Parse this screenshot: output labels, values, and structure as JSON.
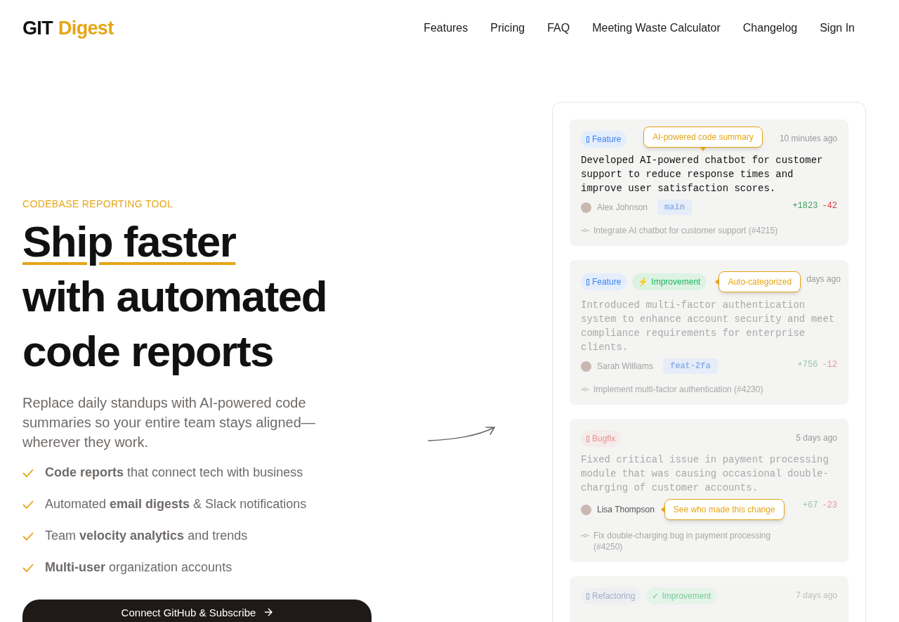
{
  "logo": {
    "first": "GIT",
    "second": "Digest"
  },
  "nav": [
    {
      "label": "Features"
    },
    {
      "label": "Pricing"
    },
    {
      "label": "FAQ"
    },
    {
      "label": "Meeting Waste Calculator"
    },
    {
      "label": "Changelog"
    },
    {
      "label": "Sign In"
    }
  ],
  "hero": {
    "eyebrow": "CODEBASE REPORTING TOOL",
    "headline_highlight": "Ship faster",
    "headline_rest": [
      "with automated",
      "code reports"
    ],
    "lead": "Replace daily standups with AI-powered code summaries so your entire team stays aligned—wherever they work.",
    "features": [
      "**Code reports** that connect tech with business",
      "Automated **email digests** & Slack notifications",
      "Team **velocity analytics** and trends",
      "**Multi-user** organization accounts"
    ],
    "cta": "Connect GitHub & Subscribe"
  },
  "cards": [
    {
      "text_faded": false,
      "badges_faded": false,
      "badges": [
        {
          "kind": "feature",
          "label": "Feature"
        }
      ],
      "time": "10 minutes ago",
      "message": "Developed AI-powered chatbot for customer support to reduce response times and improve user satisfaction scores.",
      "author": {
        "name": "Alex Johnson",
        "highlighted": false
      },
      "branch": "main",
      "additions": "+1823",
      "deletions": "-42",
      "commit": "Integrate AI chatbot for customer support (#4215)",
      "tooltip": {
        "kind": "summary",
        "text": "AI-powered code summary"
      }
    },
    {
      "text_faded": true,
      "badges_faded": false,
      "badges": [
        {
          "kind": "feature",
          "label": "Feature"
        },
        {
          "kind": "improvement",
          "icon": "⚡",
          "label": "Improvement"
        }
      ],
      "time": "days ago",
      "message": "Introduced multi-factor authentication system to enhance account security and meet compliance requirements for enterprise clients.",
      "author": {
        "name": "Sarah Williams",
        "highlighted": false
      },
      "branch": "feat-2fa",
      "additions": "+756",
      "deletions": "-12",
      "commit": "Implement multi-factor authentication (#4230)",
      "tooltip": {
        "kind": "category",
        "text": "Auto-categorized"
      }
    },
    {
      "text_faded": true,
      "badges_faded": true,
      "badges": [
        {
          "kind": "bugfix",
          "label": "Bugfix"
        }
      ],
      "time": "5 days ago",
      "message": "Fixed critical issue in payment processing module that was causing occasional double-charging of customer accounts.",
      "author": {
        "name": "Lisa Thompson",
        "highlighted": true
      },
      "additions": "+67",
      "deletions": "-23",
      "commit": "Fix double-charging bug in payment processing (#4250)",
      "tooltip": {
        "kind": "author",
        "text": "See who made this change"
      }
    },
    {
      "text_faded": true,
      "badges_faded": true,
      "badges": [
        {
          "kind": "refactoring",
          "label": "Refactoring"
        },
        {
          "kind": "improvement",
          "icon": "✓",
          "label": "Improvement"
        }
      ],
      "time": "7 days ago"
    }
  ]
}
